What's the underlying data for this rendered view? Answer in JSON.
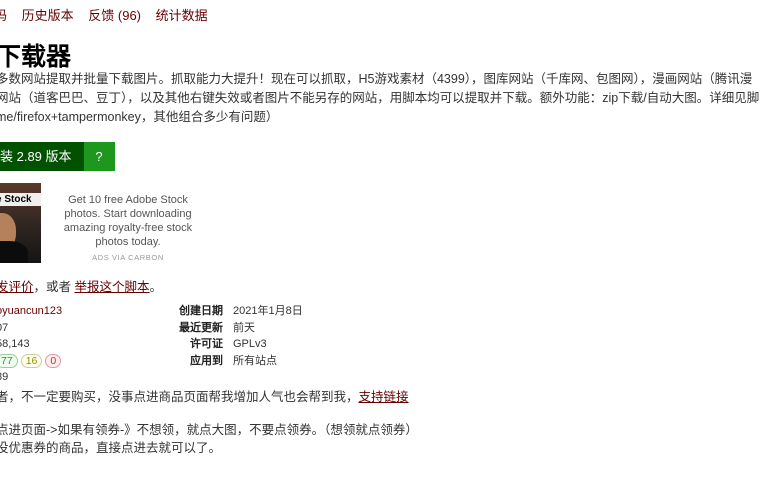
{
  "nav": {
    "items": [
      "码",
      "历史版本",
      "反馈 (96)",
      "统计数据"
    ]
  },
  "script": {
    "title": "下载器",
    "description": [
      "多数网站提取并批量下载图片。抓取能力大提升！现在可以抓取，H5游戏素材（4399），图库网站（千库网、包图网），漫画网站（腾讯漫",
      "网站（道客巴巴、豆丁），以及其他右键失效或者图片不能另存的网站，用脚本均可以提取并下载。额外功能：zip下载/自动大图。详细见脚",
      "me/firefox+tampermonkey，其他组合多少有问题）"
    ],
    "install_label": "装 2.89 版本",
    "help_label": "?"
  },
  "ad": {
    "image_label": "e Stock",
    "text": "Get 10 free Adobe Stock photos. Start downloading amazing royalty-free stock photos today.",
    "via": "ADS VIA CARBON"
  },
  "feedback_line": {
    "prefix_link": "发评价",
    "middle": "，或者 ",
    "report_link": "举报这个脚本",
    "suffix": "。"
  },
  "meta_left": {
    "author": "oyuancun123",
    "daily_installs": "07",
    "total_installs": "58,143",
    "ratings": {
      "good": "77",
      "ok": "16",
      "bad": "0"
    },
    "version": "89"
  },
  "meta_right": [
    {
      "key": "创建日期",
      "value": "2021年1月8日"
    },
    {
      "key": "最近更新",
      "value": "前天"
    },
    {
      "key": "许可证",
      "value": "GPLv3"
    },
    {
      "key": "应用到",
      "value": "所有站点"
    }
  ],
  "support": {
    "text": "者，不一定要购买，没事点进商品页面帮我增加人气也会帮到我，",
    "link": "支持链接"
  },
  "notes": [
    "点进页面->如果有领券-》不想领，就点大图，不要点领券。（想领就点领券）",
    "没优惠券的商品，直接点进去就可以了。"
  ],
  "colors": {
    "link": "#670000",
    "install_bg": "#005200",
    "help_bg": "#1e971e"
  }
}
